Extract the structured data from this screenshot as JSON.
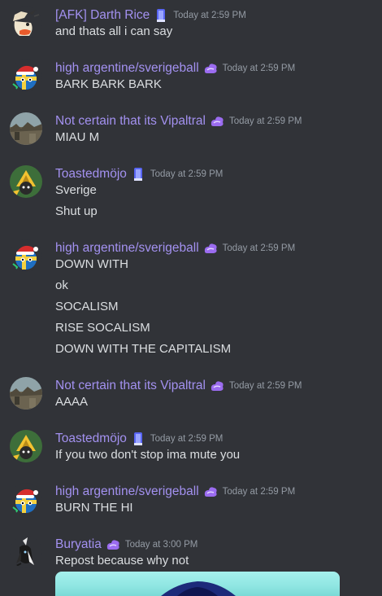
{
  "messages": [
    {
      "username": "[AFK] Darth Rice",
      "badge": "blue-book-icon",
      "timestamp": "Today at 2:59 PM",
      "avatar": "duck-head-avatar",
      "lines": [
        "and thats all i can say"
      ]
    },
    {
      "username": "high argentine/sverigeball",
      "badge": "purple-cloud-icon",
      "timestamp": "Today at 2:59 PM",
      "avatar": "countryball-santa-avatar",
      "lines": [
        "BARK BARK BARK"
      ]
    },
    {
      "username": "Not certain that its Vipaltral",
      "badge": "purple-cloud-icon",
      "timestamp": "Today at 2:59 PM",
      "avatar": "landscape-photo-avatar",
      "lines": [
        "MIAU M"
      ]
    },
    {
      "username": "Toastedmöjo",
      "badge": "blue-book-icon",
      "timestamp": "Today at 2:59 PM",
      "avatar": "yellow-hat-avatar",
      "lines": [
        "Sverige",
        "Shut up"
      ]
    },
    {
      "username": "high argentine/sverigeball",
      "badge": "purple-cloud-icon",
      "timestamp": "Today at 2:59 PM",
      "avatar": "countryball-santa-avatar",
      "lines": [
        "DOWN WITH",
        "ok",
        "SOCALISM",
        "RISE SOCALISM",
        "DOWN WITH THE CAPITALISM"
      ]
    },
    {
      "username": "Not certain that its Vipaltral",
      "badge": "purple-cloud-icon",
      "timestamp": "Today at 2:59 PM",
      "avatar": "landscape-photo-avatar",
      "lines": [
        "AAAA"
      ]
    },
    {
      "username": "Toastedmöjo",
      "badge": "blue-book-icon",
      "timestamp": "Today at 2:59 PM",
      "avatar": "yellow-hat-avatar",
      "lines": [
        "If you two don't stop ima mute you"
      ]
    },
    {
      "username": "high argentine/sverigeball",
      "badge": "purple-cloud-icon",
      "timestamp": "Today at 2:59 PM",
      "avatar": "countryball-santa-avatar",
      "lines": [
        "BURN THE HI"
      ]
    },
    {
      "username": "Buryatia",
      "badge": "purple-cloud-icon",
      "timestamp": "Today at 3:00 PM",
      "avatar": "dark-creature-avatar",
      "lines": [
        "Repost because why not"
      ],
      "attachment": "image-attachment"
    }
  ],
  "colors": {
    "background": "#313338",
    "username": "#a391f0",
    "text": "#dbdee1",
    "timestamp": "#949ba4"
  }
}
